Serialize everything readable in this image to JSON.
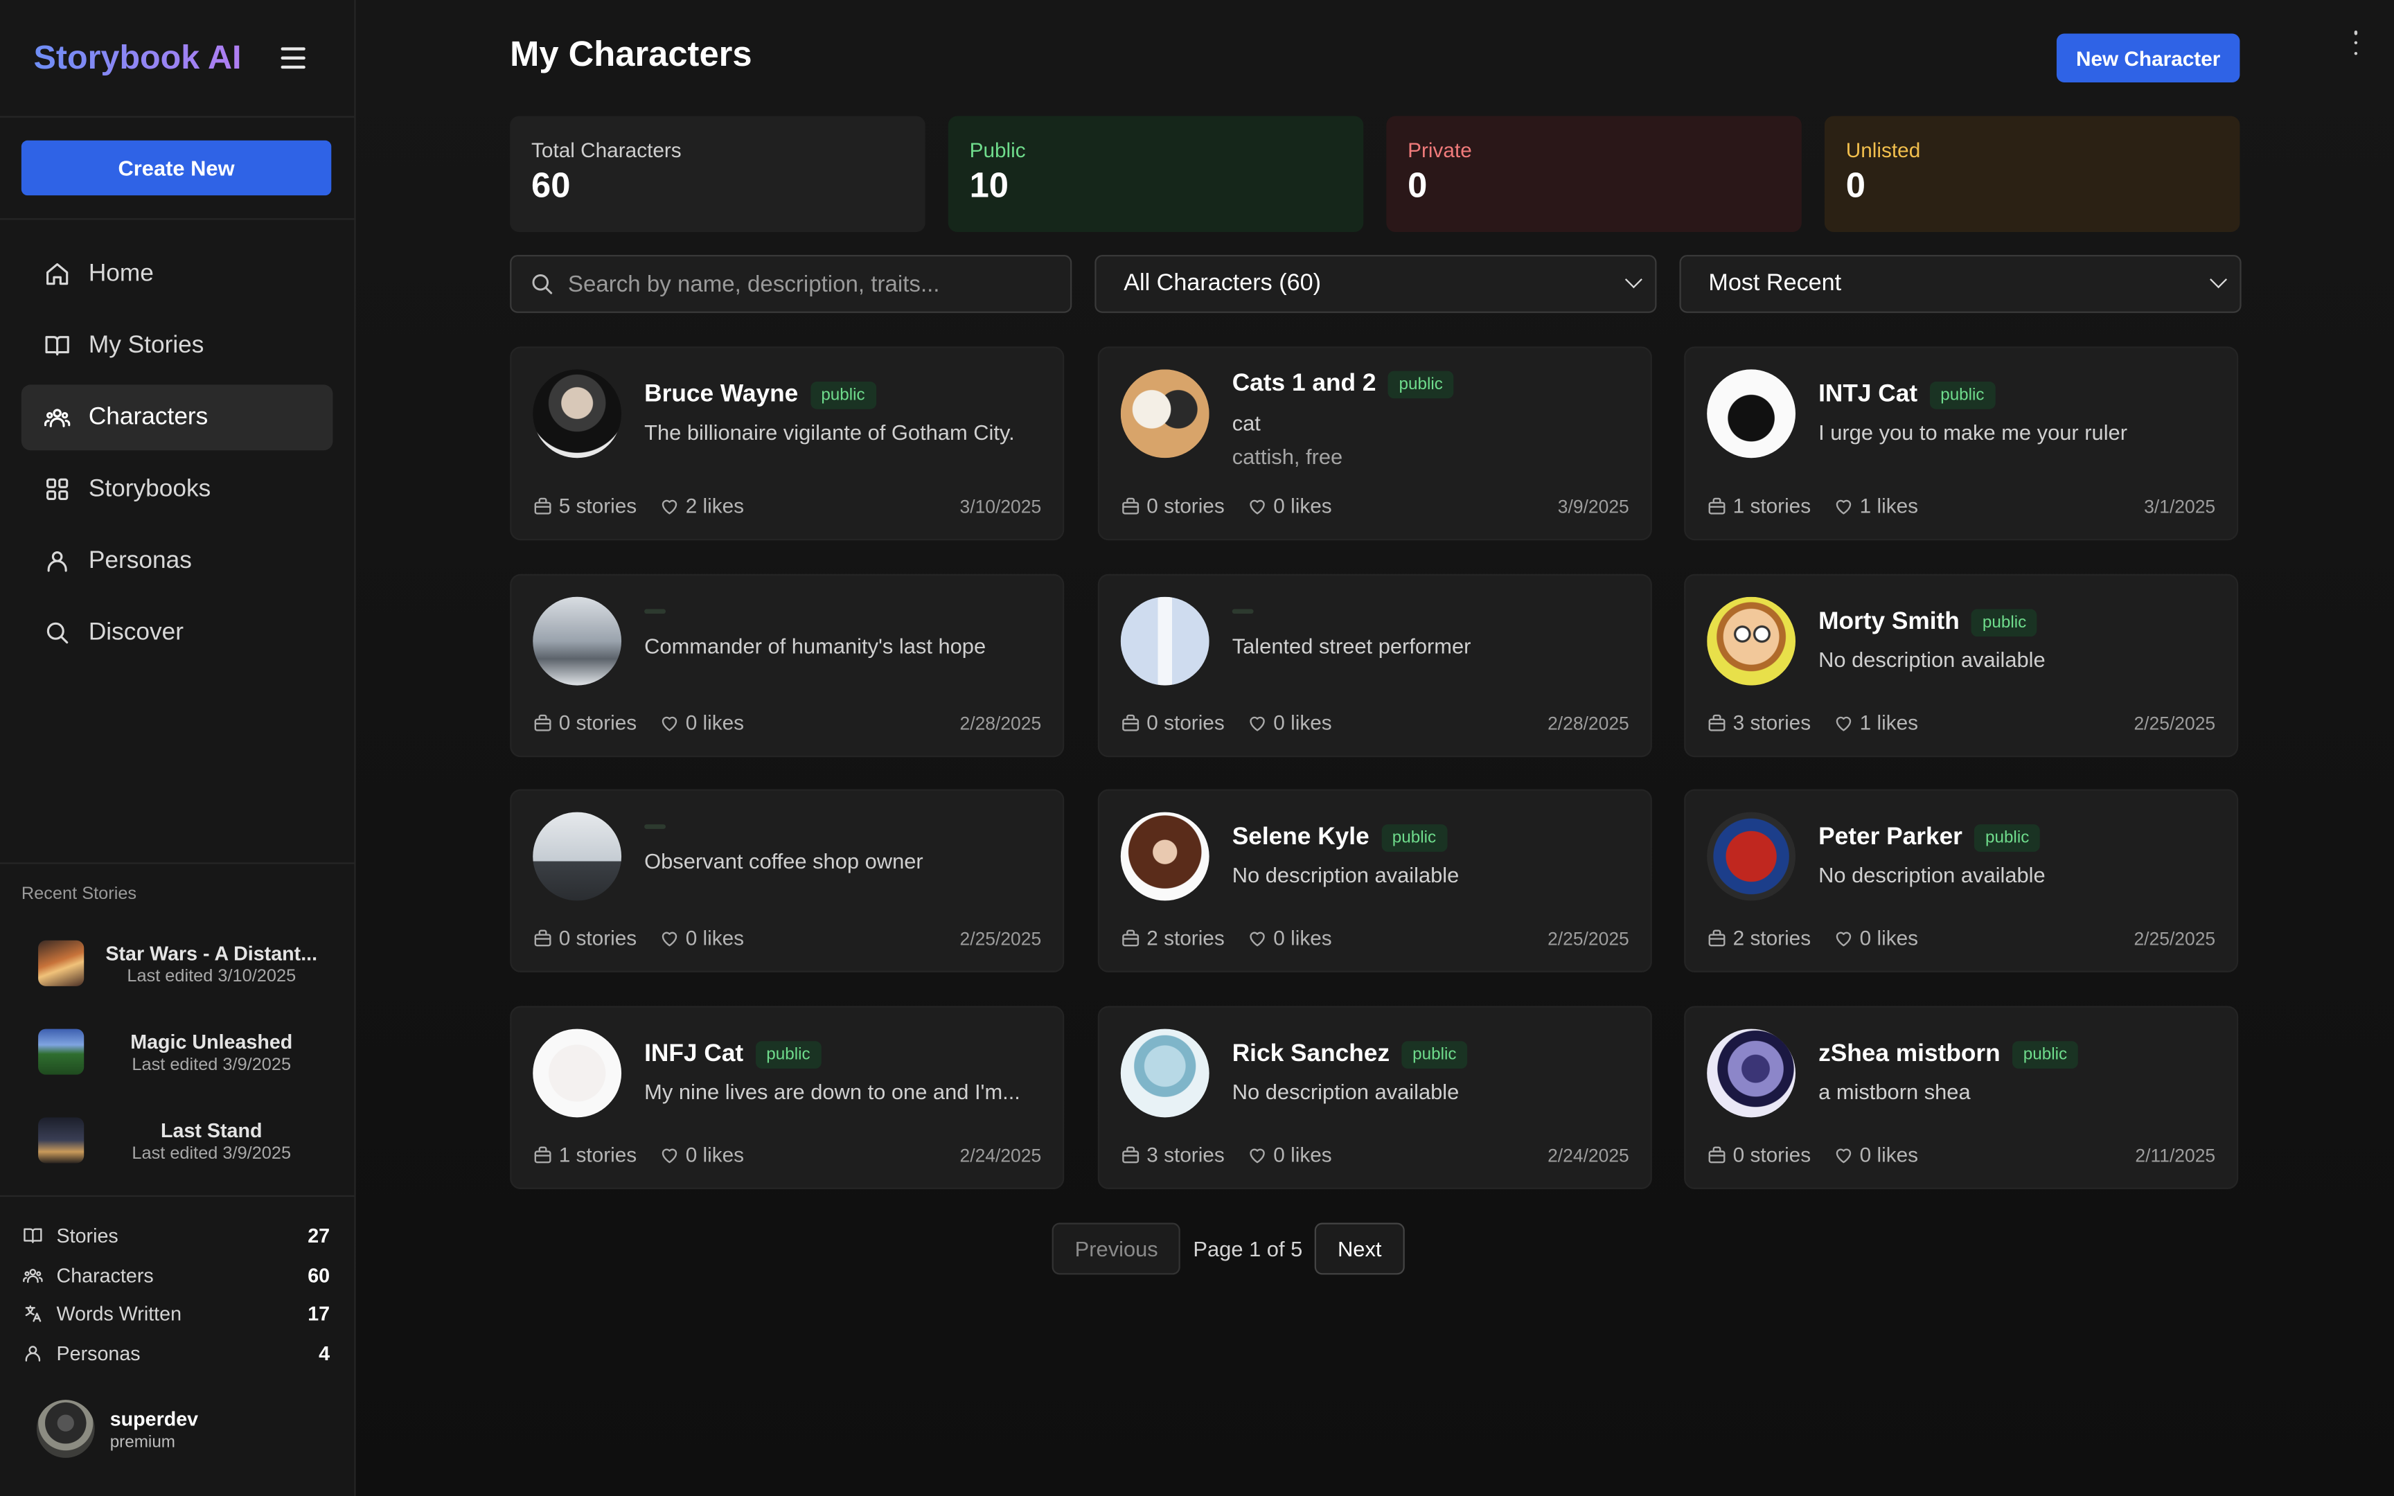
{
  "app": {
    "brand": "Storybook AI"
  },
  "sidebar": {
    "create_label": "Create New",
    "nav": [
      {
        "label": "Home",
        "icon": "home-icon"
      },
      {
        "label": "My Stories",
        "icon": "book-icon"
      },
      {
        "label": "Characters",
        "icon": "users-icon",
        "active": true
      },
      {
        "label": "Storybooks",
        "icon": "grid-icon"
      },
      {
        "label": "Personas",
        "icon": "user-icon"
      },
      {
        "label": "Discover",
        "icon": "search-icon"
      }
    ],
    "recent_title": "Recent Stories",
    "recent": [
      {
        "name": "Star Wars - A Distant...",
        "edited": "Last edited 3/10/2025"
      },
      {
        "name": "Magic Unleashed",
        "edited": "Last edited 3/9/2025"
      },
      {
        "name": "Last Stand",
        "edited": "Last edited 3/9/2025"
      }
    ],
    "stats": [
      {
        "label": "Stories",
        "value": "27",
        "icon": "book-icon"
      },
      {
        "label": "Characters",
        "value": "60",
        "icon": "users-icon"
      },
      {
        "label": "Words Written",
        "value": "17",
        "icon": "translate-icon"
      },
      {
        "label": "Personas",
        "value": "4",
        "icon": "user-icon"
      }
    ],
    "user": {
      "name": "superdev",
      "plan": "premium"
    }
  },
  "header": {
    "title": "My Characters",
    "new_label": "New Character"
  },
  "summary": [
    {
      "label": "Total Characters",
      "value": "60"
    },
    {
      "label": "Public",
      "value": "10"
    },
    {
      "label": "Private",
      "value": "0"
    },
    {
      "label": "Unlisted",
      "value": "0"
    }
  ],
  "filters": {
    "search_placeholder": "Search by name, description, traits...",
    "filter_value": "All Characters (60)",
    "sort_value": "Most Recent"
  },
  "characters": [
    {
      "name": "Bruce Wayne",
      "badge": "public",
      "desc": "The billionaire vigilante of Gotham City.",
      "stories": "5 stories",
      "likes": "2 likes",
      "date": "3/10/2025"
    },
    {
      "name": "Cats 1 and 2",
      "badge": "public",
      "desc": "cat",
      "traits": "cattish, free",
      "stories": "0 stories",
      "likes": "0 likes",
      "date": "3/9/2025"
    },
    {
      "name": "INTJ Cat",
      "badge": "public",
      "desc": "I urge you to make me your ruler",
      "stories": "1 stories",
      "likes": "1 likes",
      "date": "3/1/2025"
    },
    {
      "name": "",
      "badge": "",
      "desc": "Commander of humanity's last hope",
      "stories": "0 stories",
      "likes": "0 likes",
      "date": "2/28/2025"
    },
    {
      "name": "",
      "badge": "",
      "desc": "Talented street performer",
      "stories": "0 stories",
      "likes": "0 likes",
      "date": "2/28/2025"
    },
    {
      "name": "Morty Smith",
      "badge": "public",
      "desc": "No description available",
      "stories": "3 stories",
      "likes": "1 likes",
      "date": "2/25/2025"
    },
    {
      "name": "",
      "badge": "",
      "desc": "Observant coffee shop owner",
      "stories": "0 stories",
      "likes": "0 likes",
      "date": "2/25/2025"
    },
    {
      "name": "Selene Kyle",
      "badge": "public",
      "desc": "No description available",
      "stories": "2 stories",
      "likes": "0 likes",
      "date": "2/25/2025"
    },
    {
      "name": "Peter Parker",
      "badge": "public",
      "desc": "No description available",
      "stories": "2 stories",
      "likes": "0 likes",
      "date": "2/25/2025"
    },
    {
      "name": "INFJ Cat",
      "badge": "public",
      "desc": "My nine lives are down to one and I'm...",
      "stories": "1 stories",
      "likes": "0 likes",
      "date": "2/24/2025"
    },
    {
      "name": "Rick Sanchez",
      "badge": "public",
      "desc": "No description available",
      "stories": "3 stories",
      "likes": "0 likes",
      "date": "2/24/2025"
    },
    {
      "name": "zShea mistborn",
      "badge": "public",
      "desc": "a mistborn shea",
      "stories": "0 stories",
      "likes": "0 likes",
      "date": "2/11/2025"
    }
  ],
  "pagination": {
    "prev": "Previous",
    "info": "Page 1 of 5",
    "next": "Next"
  }
}
